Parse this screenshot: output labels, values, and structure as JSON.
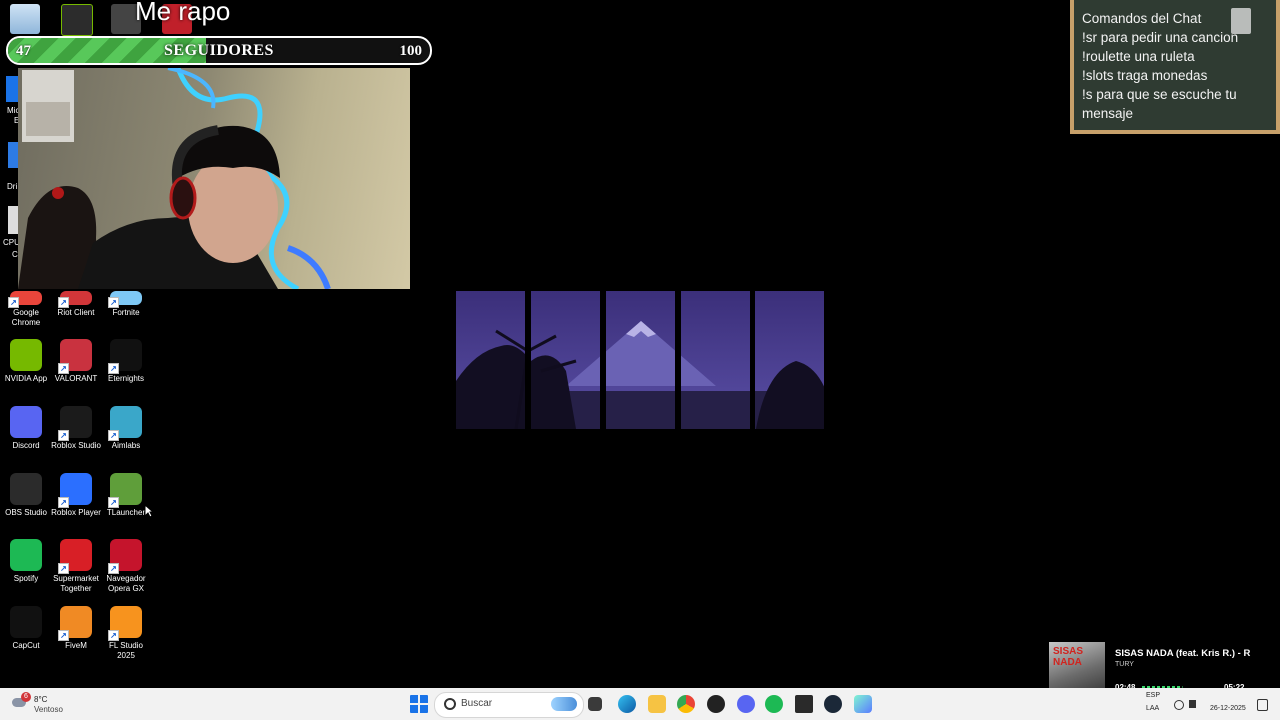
{
  "stream": {
    "title": "Me rapo",
    "followers": {
      "current": "47",
      "label": "SEGUIDORES",
      "goal": "100",
      "progress_fraction": 0.47
    }
  },
  "chat_commands": {
    "lines": [
      "Comandos del Chat",
      "!sr para pedir una cancion",
      "!roulette una ruleta",
      "!slots traga monedas",
      "!s para que se escuche tu",
      "mensaje"
    ]
  },
  "desktop_icons": [
    {
      "label": "Google Chrome",
      "icon": "chrome-icon",
      "color": "#e9453b"
    },
    {
      "label": "Riot Client",
      "icon": "riot-icon",
      "color": "#d13639"
    },
    {
      "label": "Fortnite",
      "icon": "fortnite-icon",
      "color": "#7ec8f5"
    },
    {
      "label": "NVIDIA App",
      "icon": "nvidia-icon",
      "color": "#76b900"
    },
    {
      "label": "VALORANT",
      "icon": "valorant-icon",
      "color": "#c9323f"
    },
    {
      "label": "Eternights",
      "icon": "epic-games-icon",
      "color": "#111111"
    },
    {
      "label": "Discord",
      "icon": "discord-icon",
      "color": "#5865f2"
    },
    {
      "label": "Roblox Studio",
      "icon": "roblox-studio-icon",
      "color": "#1b1b1b"
    },
    {
      "label": "Aimlabs",
      "icon": "aimlabs-icon",
      "color": "#3aa7c9"
    },
    {
      "label": "OBS Studio",
      "icon": "obs-icon",
      "color": "#2b2b2b"
    },
    {
      "label": "Roblox Player",
      "icon": "roblox-icon",
      "color": "#2b6fff"
    },
    {
      "label": "TLauncher",
      "icon": "minecraft-grass-icon",
      "color": "#5f9e3a"
    },
    {
      "label": "Spotify",
      "icon": "spotify-icon",
      "color": "#1db954"
    },
    {
      "label": "Supermarket Together",
      "icon": "supermarket-together-icon",
      "color": "#d81f26"
    },
    {
      "label": "Navegador Opera GX",
      "icon": "opera-gx-icon",
      "color": "#c5142c"
    },
    {
      "label": "CapCut",
      "icon": "capcut-icon",
      "color": "#111111"
    },
    {
      "label": "FiveM",
      "icon": "fivem-icon",
      "color": "#f08a24"
    },
    {
      "label": "FL Studio 2025",
      "icon": "fl-studio-icon",
      "color": "#f7931e"
    }
  ],
  "partial_icon_labels": [
    "Mic",
    "E",
    "Dri",
    "CPU",
    "C"
  ],
  "music": {
    "title": "SISAS NADA (feat. Kris R.) - R",
    "artist": "TURY",
    "elapsed": "02:48",
    "duration": "05:22",
    "cover_text": "SISAS NADA",
    "progress_fraction": 0.52
  },
  "taskbar": {
    "weather": {
      "temp": "8°C",
      "condition": "Ventoso",
      "badge": "6"
    },
    "search_placeholder": "Buscar",
    "tray": {
      "lang_top": "ESP",
      "lang_bottom": "LAA",
      "date": "26-12-2025"
    }
  },
  "colors": {
    "chat_bg": "#2f3b32",
    "chat_border": "#c7a06a",
    "follower_fill": "#4caf50",
    "spotify_green": "#1db954"
  }
}
